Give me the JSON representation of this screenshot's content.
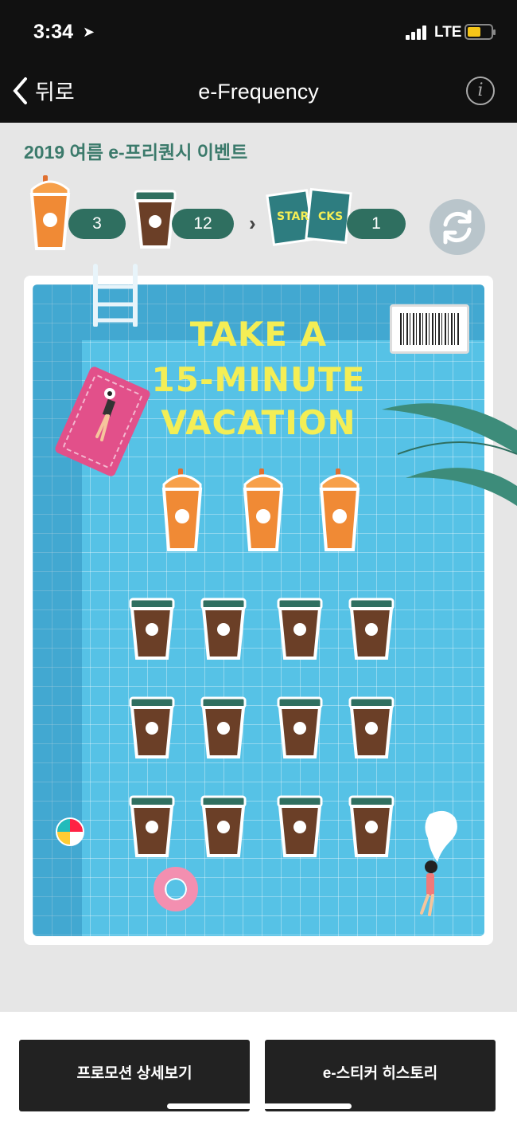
{
  "status_bar": {
    "time": "3:34",
    "location_icon": "location-arrow-icon",
    "network": "LTE",
    "battery_color": "#f5c518"
  },
  "nav": {
    "back_label": "뒤로",
    "title": "e-Frequency",
    "info_icon": "info-icon"
  },
  "event": {
    "title": "2019 여름 e-프리퀀시 이벤트"
  },
  "counters": {
    "frappuccino_count": "3",
    "regular_count": "12",
    "starbucks_stickers_count": "1",
    "sticker_text_left": "STAR",
    "sticker_text_right": "CKS"
  },
  "board": {
    "headline": [
      "TAKE A",
      "15-MINUTE",
      "VACATION"
    ],
    "frappuccino_slots": 3,
    "regular_slots": 12,
    "accent_color": "#f4ee55",
    "pool_color": "#56c2e6"
  },
  "buttons": {
    "promotion_details": "프로모션 상세보기",
    "sticker_history": "e-스티커 히스토리"
  },
  "colors": {
    "brand_green": "#2f6f60",
    "title_green": "#3b7a6b"
  }
}
